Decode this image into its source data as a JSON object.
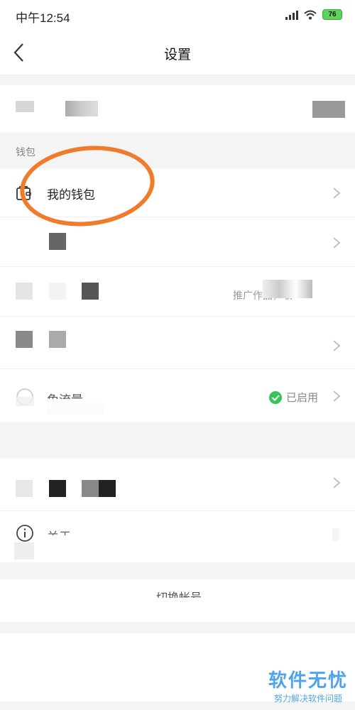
{
  "status_bar": {
    "time": "中午12:54",
    "battery": "76"
  },
  "header": {
    "title": "设置"
  },
  "sections": {
    "wallet_header": "钱包"
  },
  "rows": {
    "my_wallet_label": "我的钱包",
    "promo_fragment": "推广作品，收",
    "free_traffic_label": "免流量",
    "free_traffic_status": "已启用",
    "about_fragment": "关于",
    "switch_account_fragment": "切换帐号"
  },
  "watermark": {
    "title": "软件无忧",
    "subtitle": "努力解决软件问题"
  },
  "colors": {
    "annotation_circle": "#f07b2a",
    "enabled_green": "#38c35a",
    "watermark_blue": "#4fa3e8"
  }
}
